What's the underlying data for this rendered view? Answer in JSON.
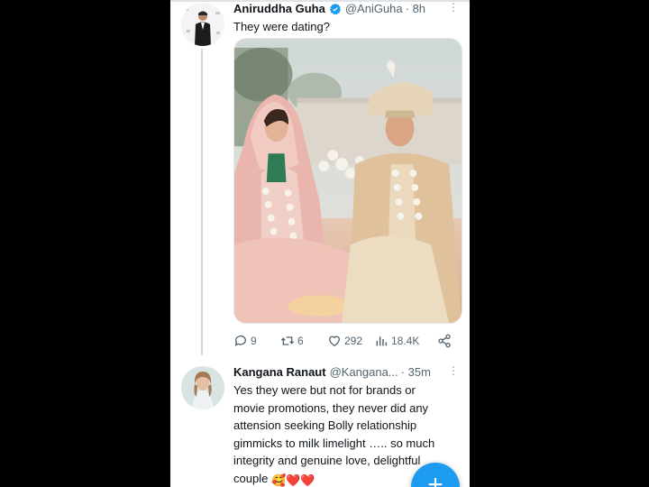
{
  "tweet": {
    "author_name": "Aniruddha Guha",
    "handle": "@AniGuha",
    "time": "· 8h",
    "more": "⋮",
    "text": "They were dating?",
    "stats": {
      "replies": "9",
      "retweets": "6",
      "likes": "292",
      "views": "18.4K"
    }
  },
  "reply": {
    "author_name": "Kangana Ranaut",
    "handle": "@Kangana...",
    "time": "· 35m",
    "more": "⋮",
    "lines": [
      "Yes they were but not for brands or",
      "movie promotions, they never did any",
      "attension seeking Bolly relationship",
      "gimmicks to milk limelight ….. so much",
      "integrity and genuine love, delightful",
      "couple"
    ],
    "emojis": "🥰❤️❤️"
  },
  "compose_button": "+",
  "colors": {
    "accent": "#1d9bf0",
    "text": "#0f1419",
    "secondary": "#536471"
  }
}
